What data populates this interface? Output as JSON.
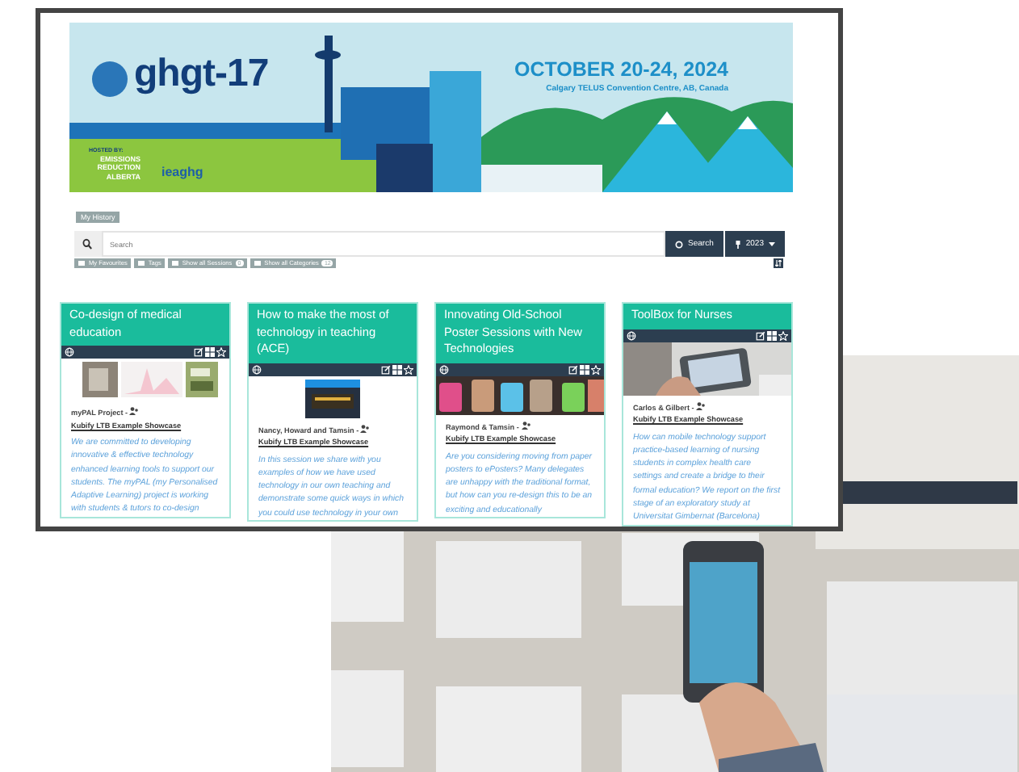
{
  "banner": {
    "logo_text": "ghgt-17",
    "date": "OCTOBER 20-24, 2024",
    "venue": "Calgary TELUS Convention Centre, AB, Canada",
    "hosted_by": "HOSTED BY:",
    "sponsors": [
      "EMISSIONS REDUCTION ALBERTA",
      "ieaghg"
    ]
  },
  "history_button": "My History",
  "search": {
    "placeholder": "Search",
    "button": "Search",
    "year": "2023"
  },
  "filters": [
    {
      "label": "My Favourites"
    },
    {
      "label": "Tags"
    },
    {
      "label": "Show all Sessions",
      "count": "0"
    },
    {
      "label": "Show all Categories",
      "count": "12"
    }
  ],
  "cards": [
    {
      "title": "Co-design of medical education",
      "authors": "myPAL Project -",
      "link": "Kubify LTB Example Showcase",
      "description": "We are committed to developing innovative & effective technology enhanced learning tools to support our students. The myPAL (my Personalised Adaptive Learning) project is working with students & tutors to co-design"
    },
    {
      "title": "How to make the most of technology in teaching (ACE)",
      "authors": "Nancy, Howard and Tamsin -",
      "link": "Kubify LTB Example Showcase",
      "description": "In this session we share with you examples of how we have used technology in our own teaching and demonstrate some quick ways in which you could use technology in your own"
    },
    {
      "title": "Innovating Old-School Poster Sessions with New Technologies",
      "authors": "Raymond & Tamsin -",
      "link": "Kubify LTB Example Showcase",
      "description": "Are you considering moving from paper posters to ePosters? Many delegates are unhappy with the traditional format, but how can you re-design this to be an exciting and educationally"
    },
    {
      "title": "ToolBox for Nurses",
      "authors": "Carlos & Gilbert -",
      "link": "Kubify LTB Example Showcase",
      "description": "How can mobile technology support practice-based learning of nursing students in complex health care settings and create a bridge to their formal education? We report on the first stage of an exploratory study at Universitat Gimbernat (Barcelona)"
    }
  ]
}
